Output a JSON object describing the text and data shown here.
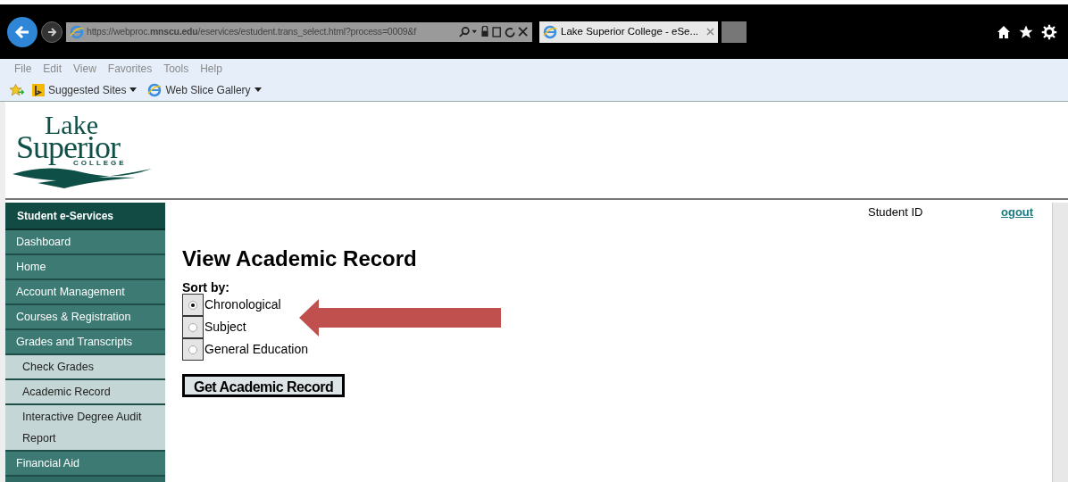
{
  "browser": {
    "address": "https://webproc.**mnscu.edu**/eservices/estudent.trans_select.html?process=0009&f",
    "tabs": [
      {
        "label": "Lake Superior College - eSe...",
        "selected": true
      }
    ],
    "menu": [
      "File",
      "Edit",
      "View",
      "Favorites",
      "Tools",
      "Help"
    ],
    "favorites": [
      {
        "label": "Suggested Sites",
        "kind": "bing"
      },
      {
        "label": "Web Slice Gallery",
        "kind": "ie"
      }
    ]
  },
  "logo": {
    "line_1": "Lake",
    "line_2": "Superior",
    "line_3": "COLLEGE"
  },
  "sidebar": {
    "title": "Student e-Services",
    "items": [
      {
        "label": "Dashboard",
        "kind": "section"
      },
      {
        "label": "Home",
        "kind": "section"
      },
      {
        "label": "Account Management",
        "kind": "section"
      },
      {
        "label": "Courses & Registration",
        "kind": "section"
      },
      {
        "label": "Grades and Transcripts",
        "kind": "section"
      },
      {
        "label": "Check Grades",
        "kind": "sub"
      },
      {
        "label": "Academic Record",
        "kind": "sub"
      },
      {
        "label": "Interactive Degree Audit Report",
        "kind": "sub"
      },
      {
        "label": "Financial Aid",
        "kind": "section"
      }
    ]
  },
  "header": {
    "student_id_label": "Student ID",
    "logout_link": "ogout"
  },
  "main": {
    "title": "View Academic Record",
    "sort_label": "Sort by:",
    "options": [
      {
        "label": "Chronological",
        "selected": true
      },
      {
        "label": "Subject",
        "selected": false
      },
      {
        "label": "General Education",
        "selected": false
      }
    ],
    "button": "Get Academic Record"
  }
}
